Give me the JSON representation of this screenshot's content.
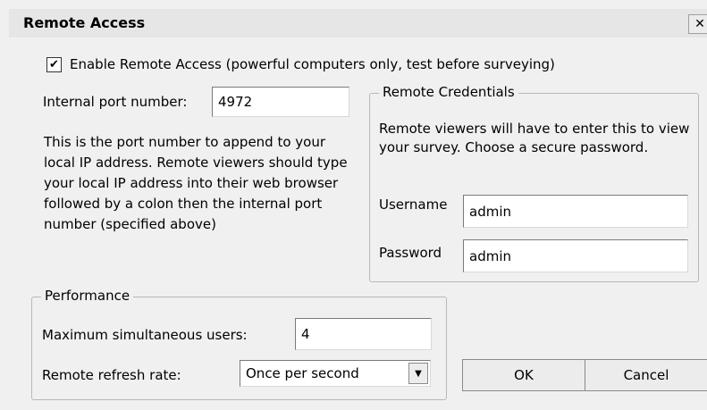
{
  "window": {
    "title": "Remote Access",
    "close_glyph": "✕"
  },
  "enable": {
    "checked": true,
    "check_glyph": "✔",
    "label": "Enable Remote Access (powerful computers only, test before surveying)"
  },
  "port": {
    "label": "Internal port number:",
    "value": "4972",
    "description": "This is the port number to append to your local IP address. Remote viewers should type your local IP address into their web browser followed by a colon then the internal port number (specified above)"
  },
  "credentials": {
    "legend": "Remote Credentials",
    "info": "Remote viewers will have to enter this to view your survey. Choose a secure password.",
    "username_label": "Username",
    "username_value": "admin",
    "password_label": "Password",
    "password_value": "admin"
  },
  "performance": {
    "legend": "Performance",
    "max_users_label": "Maximum simultaneous users:",
    "max_users_value": "4",
    "refresh_label": "Remote refresh rate:",
    "refresh_value": "Once per second",
    "dropdown_glyph": "▼"
  },
  "buttons": {
    "ok": "OK",
    "cancel": "Cancel"
  }
}
